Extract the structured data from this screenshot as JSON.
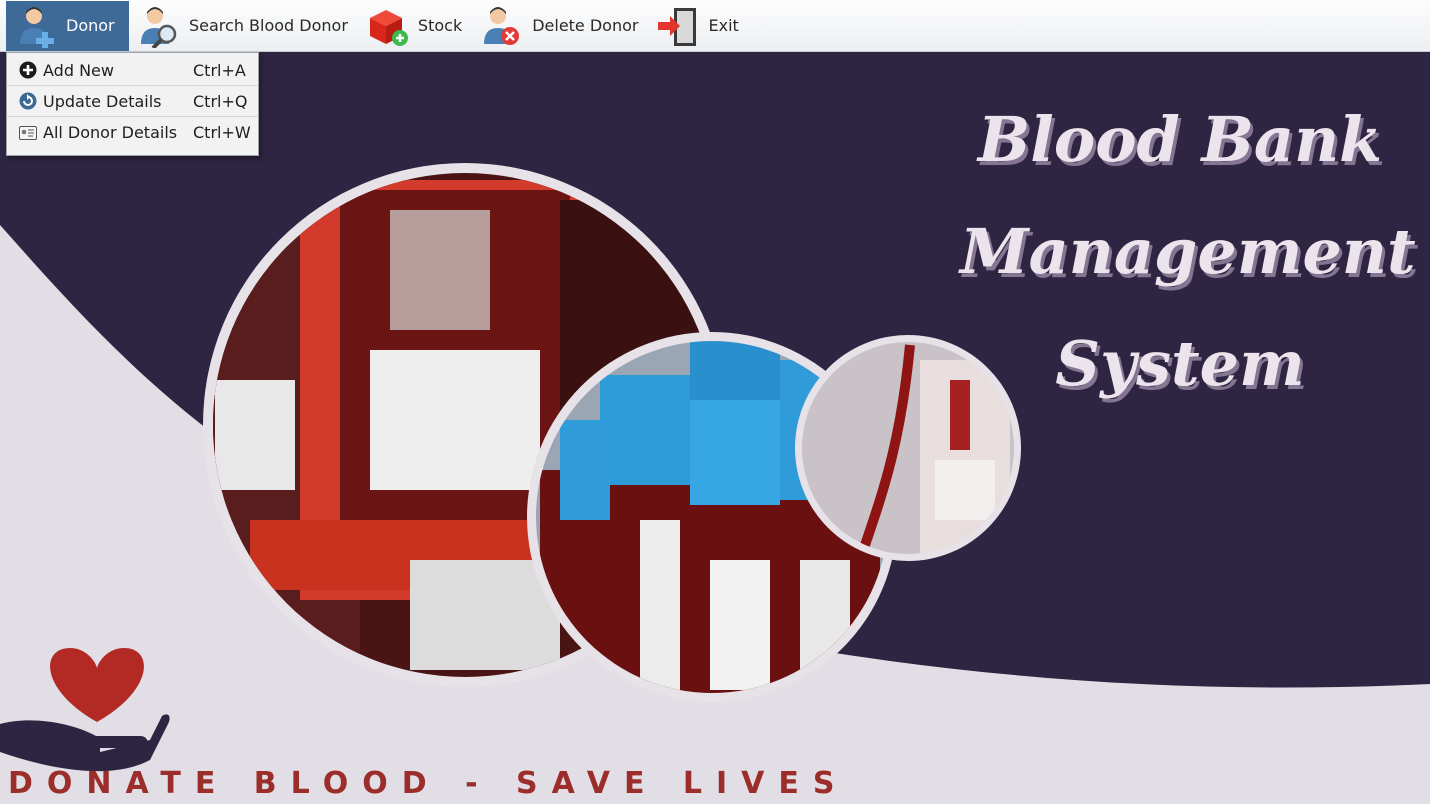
{
  "menu": {
    "items": [
      {
        "label": "Donor",
        "icon": "donor-add-icon"
      },
      {
        "label": "Search Blood Donor",
        "icon": "search-donor-icon"
      },
      {
        "label": "Stock",
        "icon": "stock-icon"
      },
      {
        "label": "Delete Donor",
        "icon": "delete-donor-icon"
      },
      {
        "label": "Exit",
        "icon": "exit-icon"
      }
    ],
    "active": "Donor"
  },
  "dropdown": {
    "items": [
      {
        "label": "Add New",
        "shortcut": "Ctrl+A",
        "icon": "plus-circle-icon"
      },
      {
        "label": "Update Details",
        "shortcut": "Ctrl+Q",
        "icon": "refresh-icon"
      },
      {
        "label": "All Donor Details",
        "shortcut": "Ctrl+W",
        "icon": "id-card-icon"
      }
    ]
  },
  "hero": {
    "title_line1": "Blood Bank",
    "title_line2": "Management",
    "title_line3": "System",
    "slogan": "DONATE BLOOD - SAVE LIVES"
  },
  "colors": {
    "background_dark": "#2e2542",
    "background_light": "#e2dee5",
    "menu_active": "#3d6a97",
    "heart": "#b32a25",
    "slogan": "#9b2d2b"
  }
}
